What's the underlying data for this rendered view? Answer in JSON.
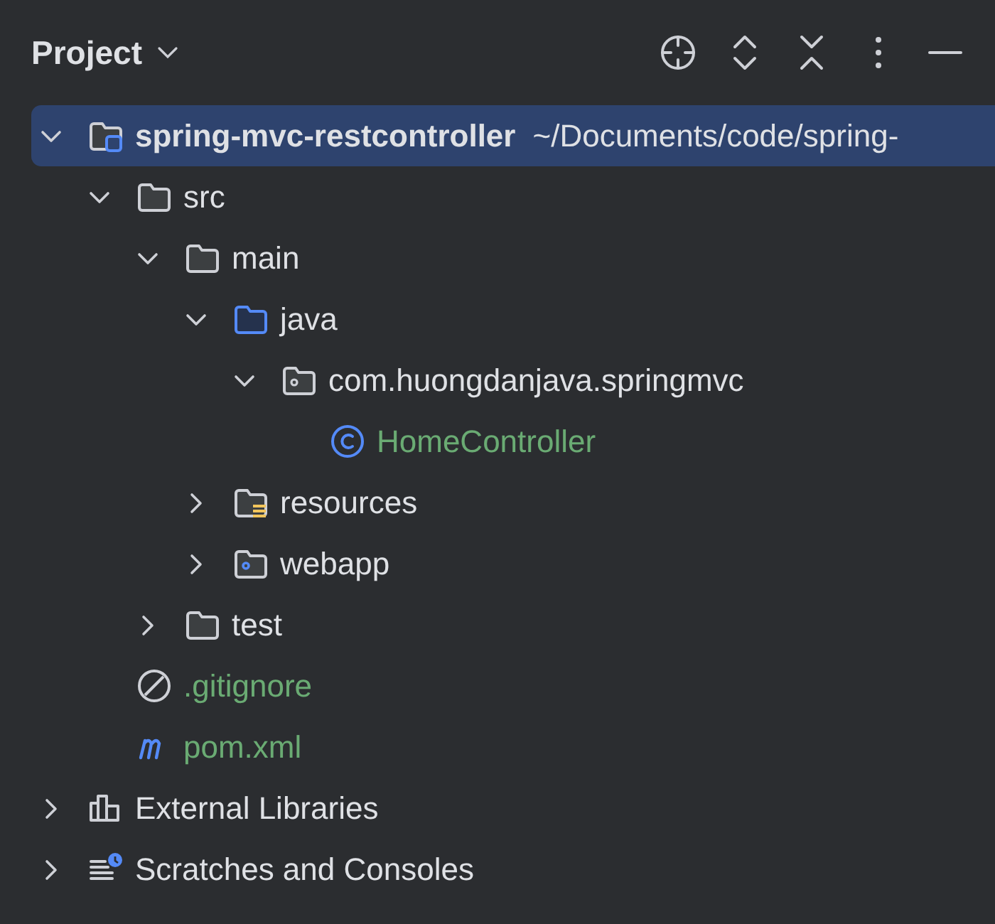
{
  "panel": {
    "title": "Project"
  },
  "tree": [
    {
      "kind": "module",
      "label": "spring-mvc-restcontroller",
      "path": "~/Documents/code/spring-",
      "selected": true,
      "expanded": true,
      "children": [
        {
          "kind": "folder",
          "label": "src",
          "selected": false,
          "expanded": true,
          "children": [
            {
              "kind": "folder",
              "label": "main",
              "selected": false,
              "expanded": true,
              "children": [
                {
                  "kind": "source-folder",
                  "label": "java",
                  "selected": false,
                  "expanded": true,
                  "children": [
                    {
                      "kind": "package",
                      "label": "com.huongdanjava.springmvc",
                      "selected": false,
                      "expanded": true,
                      "children": [
                        {
                          "kind": "class",
                          "label": "HomeController",
                          "selected": false,
                          "color": "#6aab73"
                        }
                      ]
                    }
                  ]
                },
                {
                  "kind": "resource-folder",
                  "label": "resources",
                  "selected": false,
                  "expanded": false
                },
                {
                  "kind": "web-folder",
                  "label": "webapp",
                  "selected": false,
                  "expanded": false
                }
              ]
            },
            {
              "kind": "folder",
              "label": "test",
              "selected": false,
              "expanded": false
            }
          ]
        },
        {
          "kind": "ignore-file",
          "label": ".gitignore",
          "selected": false,
          "color": "#6aab73"
        },
        {
          "kind": "maven-file",
          "label": "pom.xml",
          "selected": false,
          "color": "#6aab73"
        }
      ]
    },
    {
      "kind": "libraries",
      "label": "External Libraries",
      "selected": false,
      "expanded": false
    },
    {
      "kind": "scratches",
      "label": "Scratches and Consoles",
      "selected": false,
      "expanded": false
    }
  ]
}
